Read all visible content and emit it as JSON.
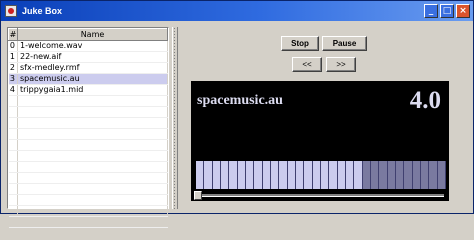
{
  "window": {
    "title": "Juke Box"
  },
  "playlist": {
    "columns": [
      "#",
      "Name"
    ],
    "rows": [
      {
        "index": "0",
        "name": "1-welcome.wav"
      },
      {
        "index": "1",
        "name": "22-new.aif"
      },
      {
        "index": "2",
        "name": "sfx-medley.rmf"
      },
      {
        "index": "3",
        "name": "spacemusic.au"
      },
      {
        "index": "4",
        "name": "trippygaia1.mid"
      }
    ],
    "selected_index": 3
  },
  "controls": {
    "stop": "Stop",
    "pause": "Pause",
    "previous": "<<",
    "next": ">>"
  },
  "display": {
    "song": "spacemusic.au",
    "tempo": "4.0",
    "level_segments": 30,
    "level_lit": 20,
    "position_fraction": 0.0
  }
}
